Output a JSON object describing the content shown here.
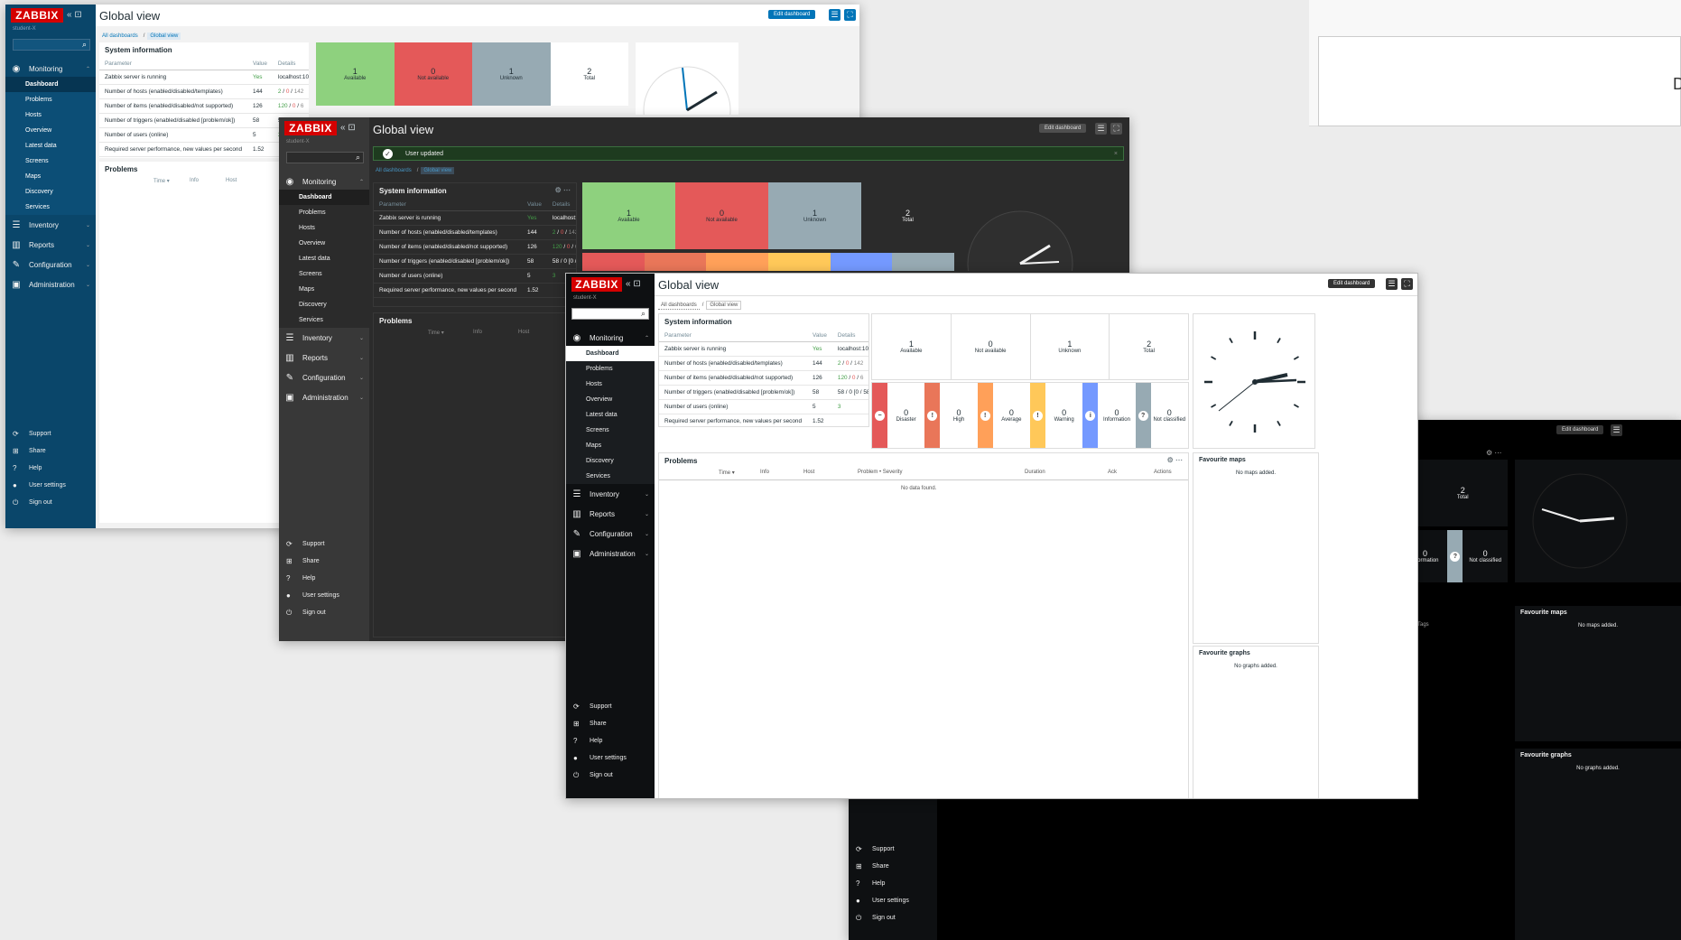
{
  "app": {
    "logo": "ZABBIX",
    "org": "student-X",
    "collapse_glyph": "«  ⊡",
    "search_icon": "search-icon"
  },
  "page": {
    "title": "Global view",
    "edit_label": "Edit dashboard",
    "breadcrumb_root": "All dashboards",
    "breadcrumb_sep": "/",
    "breadcrumb_current": "Global view"
  },
  "notification": {
    "message": "User updated"
  },
  "nav": {
    "monitoring": "Monitoring",
    "monitoring_sub": [
      "Dashboard",
      "Problems",
      "Hosts",
      "Overview",
      "Latest data",
      "Screens",
      "Maps",
      "Discovery",
      "Services"
    ],
    "inventory": "Inventory",
    "reports": "Reports",
    "configuration": "Configuration",
    "administration": "Administration"
  },
  "footer_nav": [
    "Support",
    "Share",
    "Help",
    "User settings",
    "Sign out"
  ],
  "system_info": {
    "title": "System information",
    "headers": [
      "Parameter",
      "Value",
      "Details"
    ],
    "rows": [
      {
        "param": "Zabbix server is running",
        "value": "Yes",
        "details": "localhost:10051"
      },
      {
        "param": "Number of hosts (enabled/disabled/templates)",
        "value": "144",
        "d1": "2",
        "d2": "0",
        "d3": "142"
      },
      {
        "param": "Number of items (enabled/disabled/not supported)",
        "value": "126",
        "d1": "120",
        "d2": "0",
        "d3": "6"
      },
      {
        "param": "Number of triggers (enabled/disabled [problem/ok])",
        "value": "58",
        "details": "58 / 0 [0 / 58]"
      },
      {
        "param": "Number of users (online)",
        "value": "5",
        "details": "3"
      },
      {
        "param": "Required server performance, new values per second",
        "value": "1.52",
        "details": ""
      }
    ]
  },
  "host_availability": [
    {
      "count": "1",
      "label": "Available"
    },
    {
      "count": "0",
      "label": "Not available"
    },
    {
      "count": "1",
      "label": "Unknown"
    },
    {
      "count": "2",
      "label": "Total"
    }
  ],
  "severities": [
    {
      "count": "0",
      "label": "Disaster",
      "glyph": "−"
    },
    {
      "count": "0",
      "label": "High",
      "glyph": "!"
    },
    {
      "count": "0",
      "label": "Average",
      "glyph": "!"
    },
    {
      "count": "0",
      "label": "Warning",
      "glyph": "!"
    },
    {
      "count": "0",
      "label": "Information",
      "glyph": "i"
    },
    {
      "count": "0",
      "label": "Not classified",
      "glyph": "?"
    }
  ],
  "problems": {
    "title": "Problems",
    "cols": [
      "Time ▾",
      "Info",
      "Host",
      "Problem • Severity",
      "Duration",
      "Ack",
      "Actions",
      "Tags"
    ],
    "empty": "No data found."
  },
  "favourite_maps": {
    "title": "Favourite maps",
    "empty": "No maps added."
  },
  "favourite_graphs": {
    "title": "Favourite graphs",
    "empty": "No graphs added."
  },
  "colors": {
    "sidebar_blue": "#0a466a",
    "sidebar_dark": "#2b2b2b",
    "sidebar_black": "#0e1012",
    "logo_red": "#d40000",
    "available": "#8ed17e",
    "not_available": "#e45959",
    "unknown": "#97aab3",
    "disaster": "#e45959",
    "high": "#e97659",
    "average": "#ffa059",
    "warning": "#ffc859",
    "information": "#7499ff",
    "not_classified": "#97aab3"
  },
  "truncated_text": "D"
}
